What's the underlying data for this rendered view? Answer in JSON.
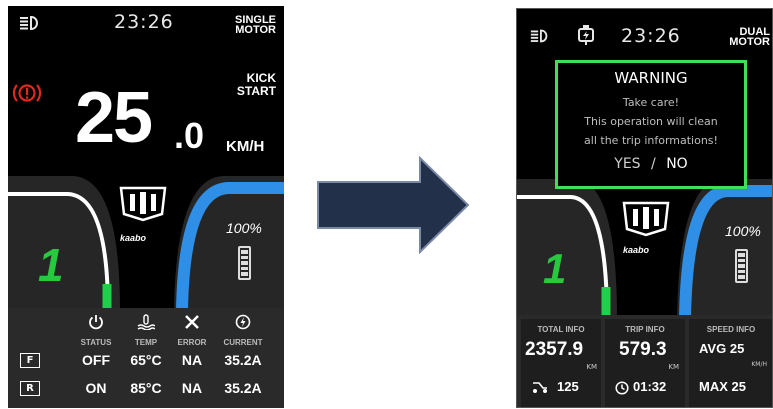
{
  "left": {
    "headlight_icon": "headlight-icon",
    "clock": "23:26",
    "mode_line1": "SINGLE",
    "mode_line2": "MOTOR",
    "brake_icon": "brake-warning-icon",
    "kick_line1": "KICK",
    "kick_line2": "START",
    "speed_int": "25",
    "speed_dec": ".0",
    "speed_unit": "KM/H",
    "gear": "1",
    "battery": "100%",
    "brand": "kaabo",
    "status_headers": [
      "STATUS",
      "TEMP",
      "ERROR",
      "CURRENT"
    ],
    "rows": [
      {
        "label": "F",
        "status": "OFF",
        "temp": "65°C",
        "error": "NA",
        "current": "35.2A"
      },
      {
        "label": "R",
        "status": "ON",
        "temp": "85°C",
        "error": "NA",
        "current": "35.2A"
      }
    ]
  },
  "right": {
    "headlight_icon": "headlight-icon",
    "charge_icon": "charging-plug-icon",
    "clock": "23:26",
    "mode_line1": "DUAL",
    "mode_line2": "MOTOR",
    "warning_title": "WARNING",
    "warning_line1": "Take care!",
    "warning_line2": "This operation will clean",
    "warning_line3": "all the trip informations!",
    "yes": "YES",
    "slash": "/",
    "no": "NO",
    "gear": "1",
    "battery": "100%",
    "brand": "kaabo",
    "total_info_label": "TOTAL INFO",
    "total_value": "2357.9",
    "total_unit": "KM",
    "total_sub_value": "125",
    "trip_info_label": "TRIP INFO",
    "trip_value": "579.3",
    "trip_unit": "KM",
    "trip_time": "01:32",
    "speed_info_label": "SPEED INFO",
    "avg_label": "AVG",
    "avg_value": "25",
    "speed_unit": "KM/H",
    "max_label": "MAX",
    "max_value": "25"
  },
  "colors": {
    "arc_blue": "#2f8fe6",
    "arc_green": "#1fd14a",
    "gear_green": "#27c93f",
    "brake_red": "#e0281e",
    "warning_border": "#3ee05a",
    "arrow_fill": "#22304a"
  }
}
